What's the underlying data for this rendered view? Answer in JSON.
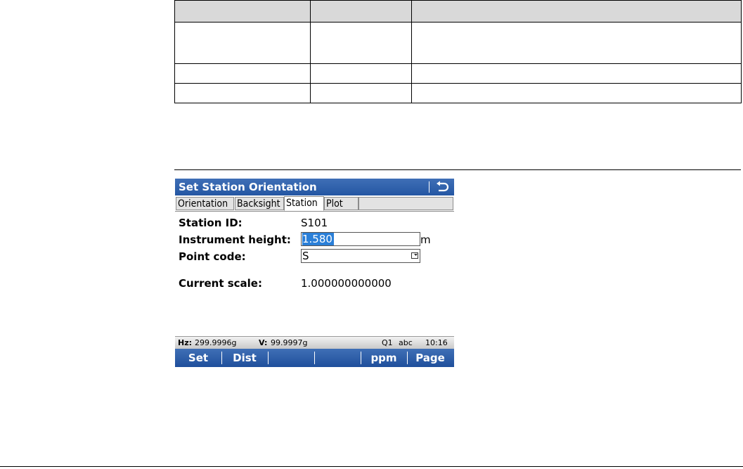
{
  "device": {
    "title": "Set Station Orientation",
    "tabs": [
      "Orientation",
      "Backsight",
      "Station",
      "Plot"
    ],
    "active_tab": "Station",
    "fields": {
      "station_id": {
        "label": "Station ID:",
        "value": "S101"
      },
      "instrument_height": {
        "label": "Instrument height:",
        "value": "1.580",
        "unit": "m"
      },
      "point_code": {
        "label": "Point code:",
        "value": "S"
      },
      "current_scale": {
        "label": "Current scale:",
        "value": "1.000000000000"
      }
    },
    "status": {
      "hz_label": "Hz:",
      "hz_value": "299.9996g",
      "v_label": "V:",
      "v_value": "99.9997g",
      "q": "Q1",
      "input_mode": "abc",
      "time": "10:16"
    },
    "softkeys": [
      "Set",
      "Dist",
      "",
      "",
      "ppm",
      "Page"
    ],
    "colors": {
      "title_bar": "#2f60ab",
      "selection": "#2a7fd8"
    }
  }
}
